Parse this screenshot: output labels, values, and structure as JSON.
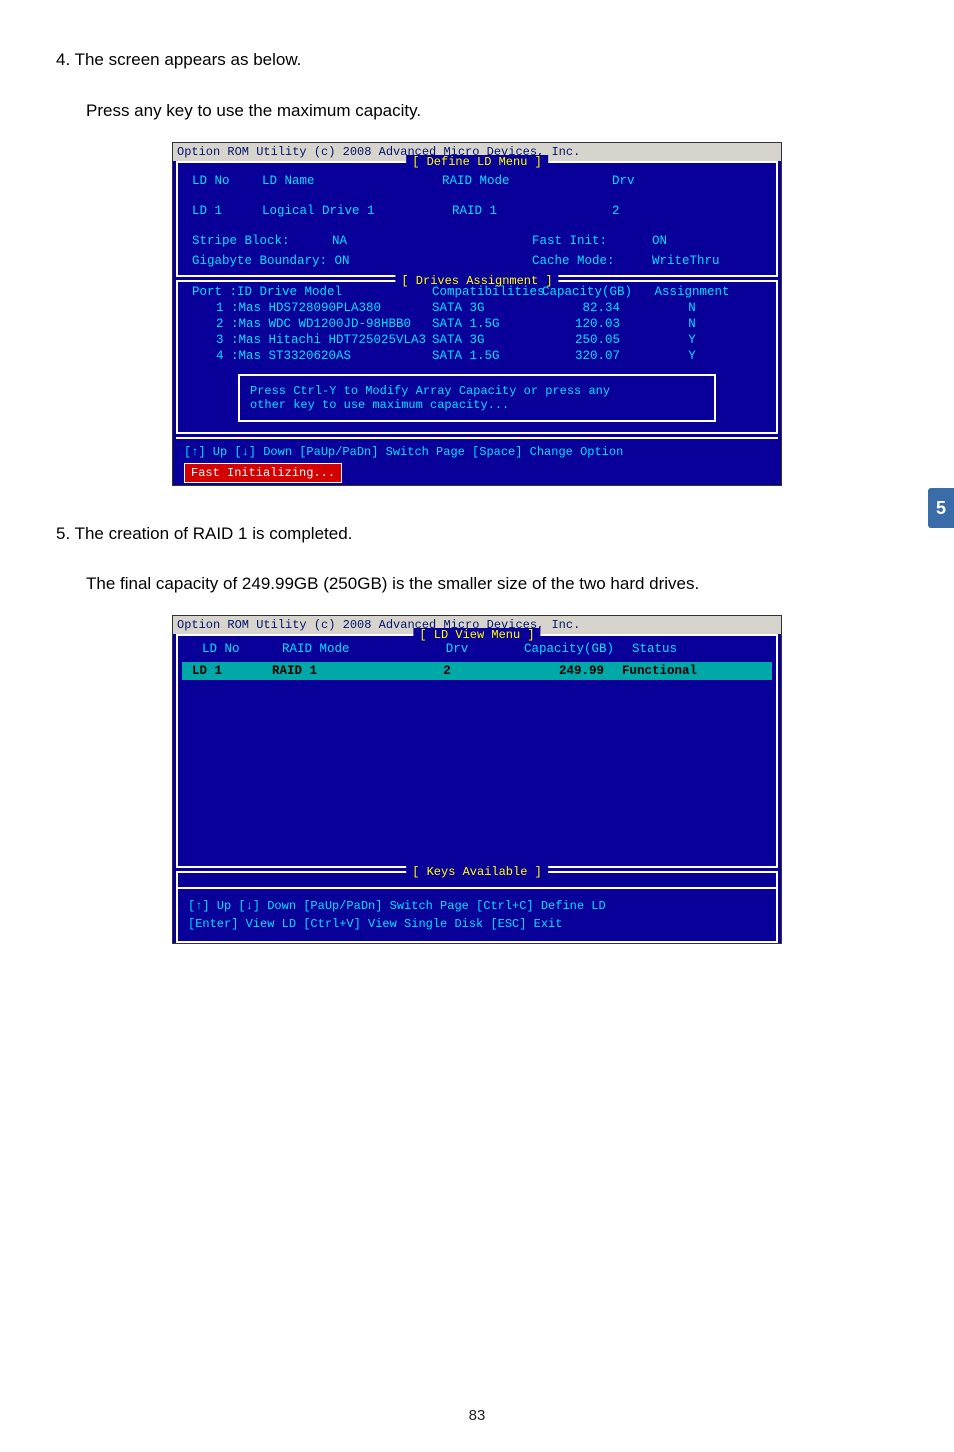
{
  "step4": {
    "line1": "4. The screen appears as below.",
    "line2": "Press any key to use the maximum capacity."
  },
  "step5": {
    "line1": "5. The creation of RAID 1 is completed.",
    "line2": "The final capacity of 249.99GB (250GB) is the smaller size of the two hard drives."
  },
  "side_tab": "5",
  "page_number": "83",
  "bios1": {
    "titlebar": "Option ROM Utility (c) 2008 Advanced Micro Devices, Inc.",
    "menu_title": "[ Define LD Menu ]",
    "headers": {
      "ld_no": "LD No",
      "ld_name": "LD Name",
      "raid_mode": "RAID Mode",
      "drv": "Drv"
    },
    "row": {
      "ld_no": "LD  1",
      "ld_name": "Logical Drive 1",
      "raid_mode": "RAID 1",
      "drv": "2"
    },
    "opts": {
      "stripe_label": "Stripe Block:",
      "stripe_val": "NA",
      "fast_label": "Fast Init:",
      "fast_val": "ON",
      "gig_label": "Gigabyte Boundary:",
      "gig_val": "ON",
      "cache_label": "Cache Mode:",
      "cache_val": "WriteThru"
    },
    "drives_title": "[ Drives Assignment ]",
    "drive_headers": {
      "port": "Port :ID  Drive Model",
      "comp": "Compatibilities",
      "cap": "Capacity(GB)",
      "assign": "Assignment"
    },
    "drives": [
      {
        "port": "1 :Mas HDS728090PLA380",
        "comp": "SATA  3G",
        "cap": "82.34",
        "assign": "N"
      },
      {
        "port": "2 :Mas WDC WD1200JD-98HBB0",
        "comp": "SATA  1.5G",
        "cap": "120.03",
        "assign": "N"
      },
      {
        "port": "3 :Mas Hitachi HDT725025VLA3",
        "comp": "SATA  3G",
        "cap": "250.05",
        "assign": "Y"
      },
      {
        "port": "4 :Mas ST3320620AS",
        "comp": "SATA  1.5G",
        "cap": "320.07",
        "assign": "Y"
      }
    ],
    "modal": {
      "l1": "Press Ctrl-Y to Modify Array Capacity or press any",
      "l2": "other key to use maximum capacity..."
    },
    "footer_keys": "[↑] Up    [↓] Down    [PaUp/PaDn] Switch Page    [Space] Change Option",
    "footer_status": "Fast  Initializing..."
  },
  "bios2": {
    "titlebar": "Option ROM Utility (c) 2008 Advanced Micro Devices, Inc.",
    "menu_title": "[ LD View Menu ]",
    "headers": {
      "ld_no": "LD No",
      "raid_mode": "RAID Mode",
      "drv": "Drv",
      "cap": "Capacity(GB)",
      "status": "Status"
    },
    "row": {
      "ld_no": "LD   1",
      "raid_mode": "RAID 1",
      "drv": "2",
      "cap": "249.99",
      "status": "Functional"
    },
    "keys_title": "[ Keys Available ]",
    "keys_l1": "[↑] Up    [↓] Down    [PaUp/PaDn] Switch Page    [Ctrl+C] Define LD",
    "keys_l2": "[Enter] View LD    [Ctrl+V] View Single Disk    [ESC] Exit"
  }
}
